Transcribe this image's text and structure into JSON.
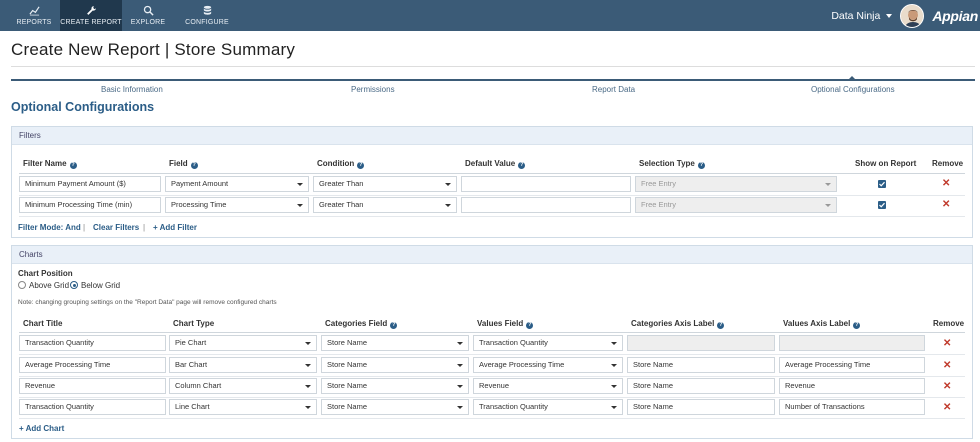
{
  "nav": {
    "items": [
      {
        "label": "REPORTS",
        "icon": "chart-line-icon"
      },
      {
        "label": "CREATE REPORT",
        "icon": "wrench-icon"
      },
      {
        "label": "EXPLORE",
        "icon": "search-icon"
      },
      {
        "label": "CONFIGURE",
        "icon": "database-icon"
      }
    ],
    "user": "Data Ninja",
    "logo": "Appian"
  },
  "page": {
    "title": "Create New Report | Store Summary",
    "steps": [
      "Basic Information",
      "Permissions",
      "Report Data",
      "Optional Configurations"
    ],
    "section_title": "Optional Configurations"
  },
  "filters": {
    "panel_title": "Filters",
    "headers": [
      "Filter Name",
      "Field",
      "Condition",
      "Default Value",
      "Selection Type",
      "Show on Report",
      "Remove"
    ],
    "rows": [
      {
        "name": "Minimum Payment Amount ($)",
        "field": "Payment Amount",
        "condition": "Greater Than",
        "default": "",
        "selection": "Free Entry",
        "show": true
      },
      {
        "name": "Minimum Processing Time (min)",
        "field": "Processing Time",
        "condition": "Greater Than",
        "default": "",
        "selection": "Free Entry",
        "show": true
      }
    ],
    "mode_label": "Filter Mode: And",
    "separator": "|",
    "clear_label": "Clear Filters",
    "add_label": "Add Filter"
  },
  "charts": {
    "panel_title": "Charts",
    "position_label": "Chart Position",
    "options": [
      "Above Grid",
      "Below Grid"
    ],
    "selected_option": "Below Grid",
    "note": "Note: changing grouping settings on the \"Report Data\" page will remove configured charts",
    "headers": [
      "Chart Title",
      "Chart Type",
      "Categories Field",
      "Values Field",
      "Categories Axis Label",
      "Values Axis Label",
      "Remove"
    ],
    "rows": [
      {
        "title": "Transaction Quantity",
        "type": "Pie Chart",
        "categories": "Store Name",
        "values": "Transaction Quantity",
        "cat_label": "",
        "val_label": "",
        "labels_disabled": true
      },
      {
        "title": "Average Processing Time",
        "type": "Bar Chart",
        "categories": "Store Name",
        "values": "Average Processing Time",
        "cat_label": "Store Name",
        "val_label": "Average Processing Time",
        "labels_disabled": false
      },
      {
        "title": "Revenue",
        "type": "Column Chart",
        "categories": "Store Name",
        "values": "Revenue",
        "cat_label": "Store Name",
        "val_label": "Revenue",
        "labels_disabled": false
      },
      {
        "title": "Transaction Quantity",
        "type": "Line Chart",
        "categories": "Store Name",
        "values": "Transaction Quantity",
        "cat_label": "Store Name",
        "val_label": "Number of Transactions",
        "labels_disabled": false
      }
    ],
    "add_label": "Add Chart"
  },
  "colors": {
    "nav": "#3b5b77",
    "nav_active": "#20384d",
    "accent": "#2b5d87",
    "remove": "#c0392b"
  }
}
